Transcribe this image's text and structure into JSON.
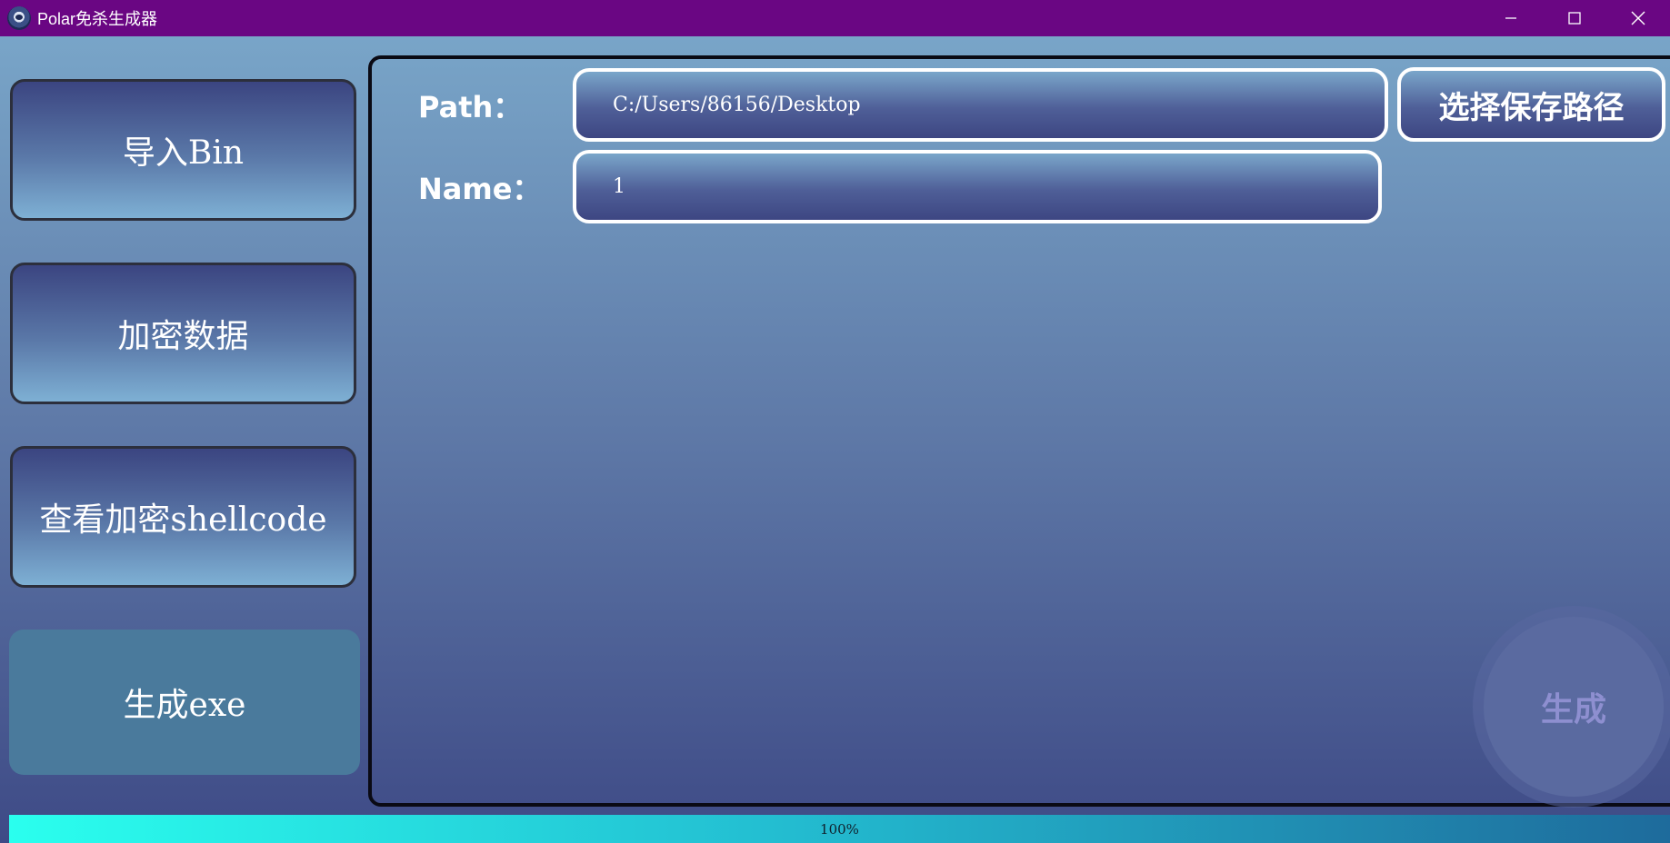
{
  "window": {
    "title": "Polar免杀生成器",
    "icon": "polar-app-icon",
    "controls": [
      "minimize-icon",
      "maximize-icon",
      "close-icon"
    ]
  },
  "sidebar": {
    "items": [
      {
        "label": "导入Bin"
      },
      {
        "label": "加密数据"
      },
      {
        "label": "查看加密shellcode"
      },
      {
        "label": "生成exe"
      }
    ]
  },
  "form": {
    "path_label": "Path：",
    "path_value": "C:/Users/86156/Desktop",
    "name_label": "Name：",
    "name_value": "1",
    "choose_path_button": "选择保存路径",
    "generate_button": "生成"
  },
  "progress": {
    "value": 1.0,
    "text": "100%"
  },
  "colors": {
    "titlebar": "#6a0683",
    "progress_start": "#2affee",
    "progress_end": "#1e6b9c"
  }
}
